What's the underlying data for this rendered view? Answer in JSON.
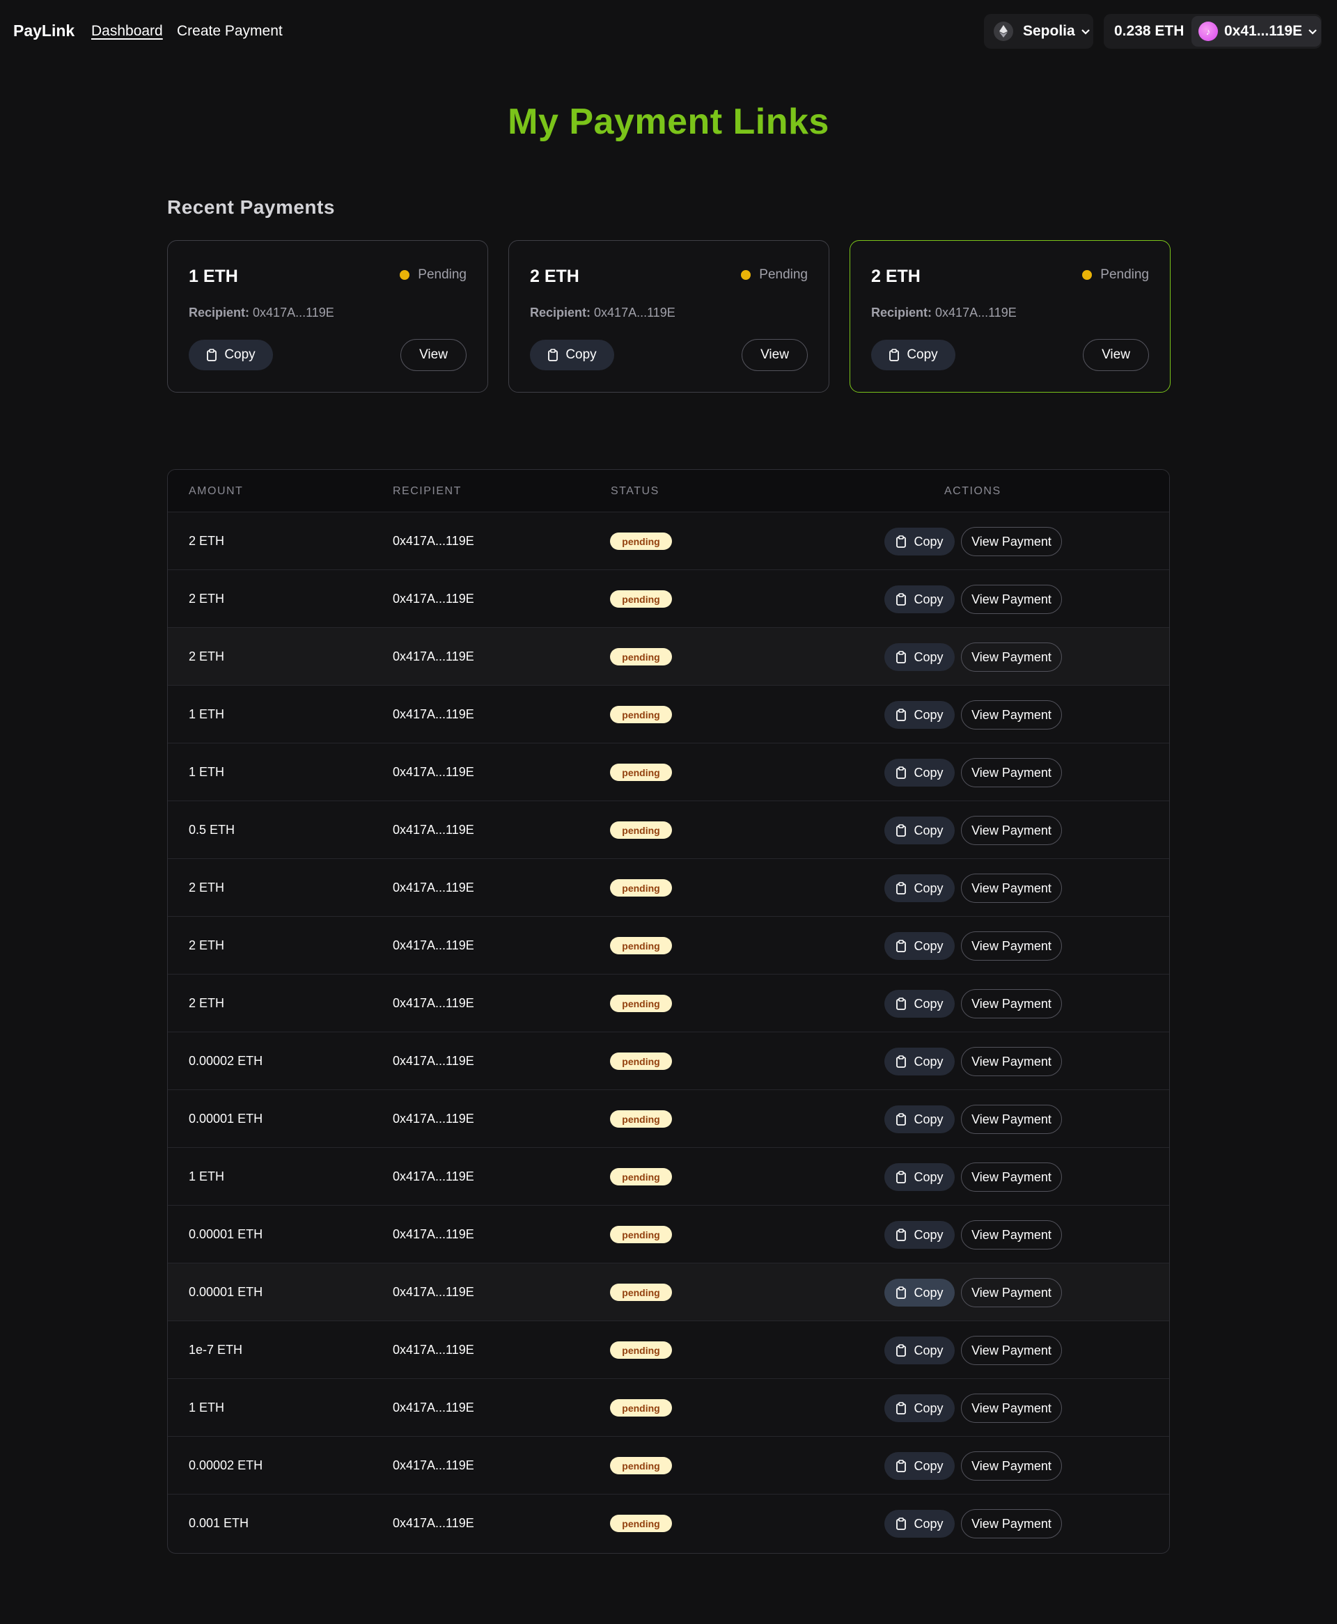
{
  "nav": {
    "brand": "PayLink",
    "links": [
      "Dashboard",
      "Create Payment"
    ],
    "network": "Sepolia",
    "balance": "0.238 ETH",
    "address": "0x41...119E"
  },
  "colors": {
    "accent": "#7bc41a",
    "background": "#111112",
    "pending_dot": "#eab308",
    "badge_bg": "#fef3c7",
    "badge_text": "#92400e"
  },
  "page_title": "My Payment Links",
  "recent": {
    "title": "Recent Payments",
    "recipient_label": "Recipient:",
    "copy_label": "Copy",
    "view_label": "View",
    "cards": [
      {
        "amount": "1 ETH",
        "status": "Pending",
        "recipient": "0x417A...119E"
      },
      {
        "amount": "2 ETH",
        "status": "Pending",
        "recipient": "0x417A...119E"
      },
      {
        "amount": "2 ETH",
        "status": "Pending",
        "recipient": "0x417A...119E"
      }
    ]
  },
  "table": {
    "headers": {
      "amount": "AMOUNT",
      "recipient": "RECIPIENT",
      "status": "STATUS",
      "actions": "ACTIONS"
    },
    "copy_label": "Copy",
    "view_label": "View Payment",
    "rows": [
      {
        "amount": "2 ETH",
        "recipient": "0x417A...119E",
        "status": "pending"
      },
      {
        "amount": "2 ETH",
        "recipient": "0x417A...119E",
        "status": "pending"
      },
      {
        "amount": "2 ETH",
        "recipient": "0x417A...119E",
        "status": "pending"
      },
      {
        "amount": "1 ETH",
        "recipient": "0x417A...119E",
        "status": "pending"
      },
      {
        "amount": "1 ETH",
        "recipient": "0x417A...119E",
        "status": "pending"
      },
      {
        "amount": "0.5 ETH",
        "recipient": "0x417A...119E",
        "status": "pending"
      },
      {
        "amount": "2 ETH",
        "recipient": "0x417A...119E",
        "status": "pending"
      },
      {
        "amount": "2 ETH",
        "recipient": "0x417A...119E",
        "status": "pending"
      },
      {
        "amount": "2 ETH",
        "recipient": "0x417A...119E",
        "status": "pending"
      },
      {
        "amount": "0.00002 ETH",
        "recipient": "0x417A...119E",
        "status": "pending"
      },
      {
        "amount": "0.00001 ETH",
        "recipient": "0x417A...119E",
        "status": "pending"
      },
      {
        "amount": "1 ETH",
        "recipient": "0x417A...119E",
        "status": "pending"
      },
      {
        "amount": "0.00001 ETH",
        "recipient": "0x417A...119E",
        "status": "pending"
      },
      {
        "amount": "0.00001 ETH",
        "recipient": "0x417A...119E",
        "status": "pending"
      },
      {
        "amount": "1e-7 ETH",
        "recipient": "0x417A...119E",
        "status": "pending"
      },
      {
        "amount": "1 ETH",
        "recipient": "0x417A...119E",
        "status": "pending"
      },
      {
        "amount": "0.00002 ETH",
        "recipient": "0x417A...119E",
        "status": "pending"
      },
      {
        "amount": "0.001 ETH",
        "recipient": "0x417A...119E",
        "status": "pending"
      }
    ]
  }
}
